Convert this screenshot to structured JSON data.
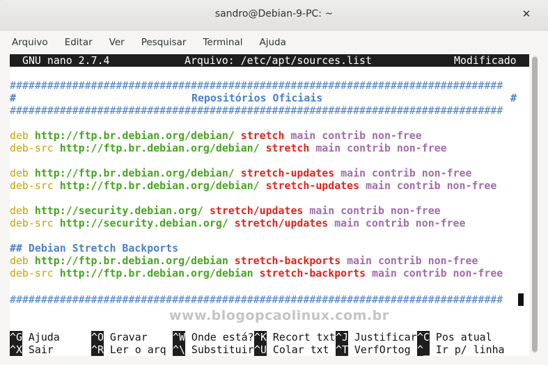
{
  "window": {
    "title": "sandro@Debian-9-PC: ~",
    "close_glyph": "✕"
  },
  "menu": [
    "Arquivo",
    "Editar",
    "Ver",
    "Pesquisar",
    "Terminal",
    "Ajuda"
  ],
  "nano": {
    "app": "GNU nano 2.7.4",
    "file": "Arquivo: /etc/apt/sources.list",
    "status": "Modificado"
  },
  "content": {
    "hash_line": "###############################################################################",
    "heading_left": "#",
    "heading": "Repositórios Oficiais",
    "heading_right": "#",
    "backports_comment": "## Debian Stretch Backports",
    "entries": [
      {
        "type": "deb",
        "url": "http://ftp.br.debian.org/debian/",
        "suite": "stretch",
        "components": "main contrib non-free"
      },
      {
        "type": "deb-src",
        "url": "http://ftp.br.debian.org/debian/",
        "suite": "stretch",
        "components": "main contrib non-free"
      },
      {
        "type": "deb",
        "url": "http://ftp.br.debian.org/debian/",
        "suite": "stretch-updates",
        "components": "main contrib non-free"
      },
      {
        "type": "deb-src",
        "url": "http://ftp.br.debian.org/debian/",
        "suite": "stretch-updates",
        "components": "main contrib non-free"
      },
      {
        "type": "deb",
        "url": "http://security.debian.org/",
        "suite": "stretch/updates",
        "components": "main contrib non-free"
      },
      {
        "type": "deb-src",
        "url": "http://security.debian.org/",
        "suite": "stretch/updates",
        "components": "main contrib non-free"
      },
      {
        "type": "deb",
        "url": "http://ftp.br.debian.org/debian",
        "suite": "stretch-backports",
        "components": "main contrib non-free"
      },
      {
        "type": "deb-src",
        "url": "http://ftp.br.debian.org/debian",
        "suite": "stretch-backports",
        "components": "main contrib non-free"
      }
    ]
  },
  "watermark": "www.blogopcaolinux.com.br",
  "shortcuts": {
    "row1": [
      {
        "key": "^G",
        "label": "Ajuda"
      },
      {
        "key": "^O",
        "label": "Gravar"
      },
      {
        "key": "^W",
        "label": "Onde está?"
      },
      {
        "key": "^K",
        "label": "Recort txt"
      },
      {
        "key": "^J",
        "label": "Justificar"
      },
      {
        "key": "^C",
        "label": "Pos atual"
      }
    ],
    "row2": [
      {
        "key": "^X",
        "label": "Sair"
      },
      {
        "key": "^R",
        "label": "Ler o arq"
      },
      {
        "key": "^\\",
        "label": "Substituir"
      },
      {
        "key": "^U",
        "label": "Colar txt"
      },
      {
        "key": "^T",
        "label": "VerfOrtog"
      },
      {
        "key": "^_",
        "label": "Ir p/ linha"
      }
    ]
  }
}
